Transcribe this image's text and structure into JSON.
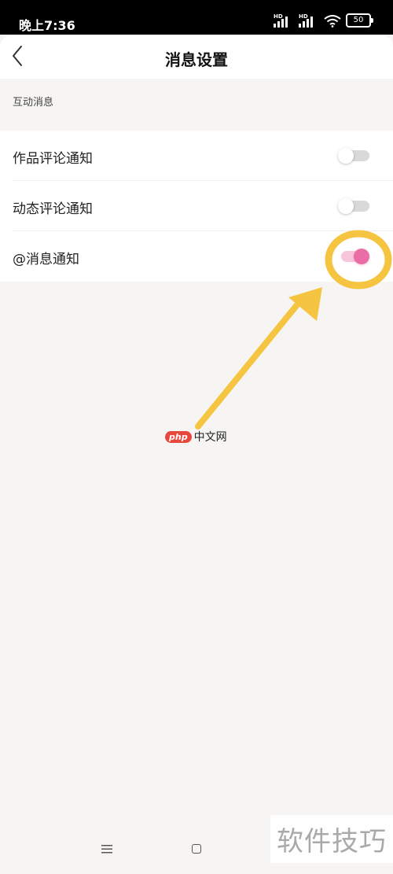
{
  "status_bar": {
    "time": "晚上7:36",
    "signal_badge": "HD",
    "battery": "50"
  },
  "header": {
    "title": "消息设置"
  },
  "section": {
    "label": "互动消息"
  },
  "settings": [
    {
      "label": "作品评论通知",
      "enabled": false
    },
    {
      "label": "动态评论通知",
      "enabled": false
    },
    {
      "label": "@消息通知",
      "enabled": true
    }
  ],
  "colors": {
    "accent": "#ea6ea6",
    "annotation": "#f5c542"
  },
  "watermarks": {
    "php_logo": "php",
    "php_suffix": "中文网",
    "skills": "软件技巧"
  }
}
